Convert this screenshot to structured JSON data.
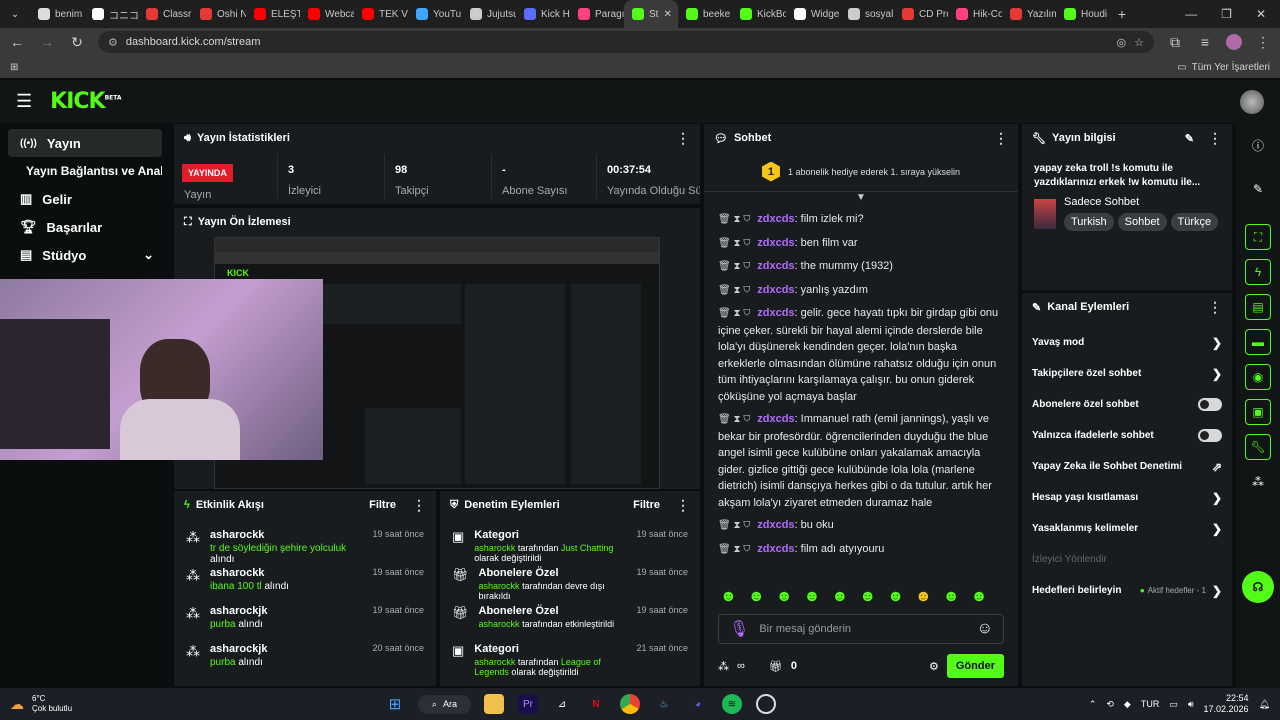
{
  "browser": {
    "tabs": [
      {
        "label": "benim",
        "color": "#dddddd"
      },
      {
        "label": "コニコ",
        "color": "#ffffff"
      },
      {
        "label": "Classr",
        "color": "#e53935"
      },
      {
        "label": "Oshi N",
        "color": "#e53935"
      },
      {
        "label": "ELEŞTİ",
        "color": "#ff0000"
      },
      {
        "label": "Webca",
        "color": "#ff0000"
      },
      {
        "label": "TEK Vİ",
        "color": "#ff0000"
      },
      {
        "label": "YouTu",
        "color": "#3ea6ff"
      },
      {
        "label": "Jujutsu",
        "color": "#cccccc"
      },
      {
        "label": "Kick H",
        "color": "#5b6cff"
      },
      {
        "label": "Paragı",
        "color": "#ff4081"
      },
      {
        "label": "St",
        "color": "#53fc18"
      },
      {
        "label": "beeke",
        "color": "#53fc18"
      },
      {
        "label": "KickBo",
        "color": "#53fc18"
      },
      {
        "label": "Widge",
        "color": "#ffffff"
      },
      {
        "label": "sosyal",
        "color": "#cccccc"
      },
      {
        "label": "CD Pro",
        "color": "#e53935"
      },
      {
        "label": "Hik-Co",
        "color": "#ff4081"
      },
      {
        "label": "Yazılım",
        "color": "#e53935"
      },
      {
        "label": "Houdi",
        "color": "#53fc18"
      }
    ],
    "url": "dashboard.kick.com/stream",
    "bookmarks_label": "Tüm Yer İşaretleri"
  },
  "kick": {
    "logo": "KICK",
    "beta": "BETA"
  },
  "sidebar": {
    "items": [
      {
        "label": "Yayın",
        "icon": "broadcast-icon"
      },
      {
        "label": "Yayın Bağlantısı ve Anahtarı",
        "icon": ""
      },
      {
        "label": "Gelir",
        "icon": "revenue-icon"
      },
      {
        "label": "Başarılar",
        "icon": "trophy-icon"
      },
      {
        "label": "Stüdyo",
        "icon": "studio-icon"
      }
    ]
  },
  "stats": {
    "title": "Yayın İstatistikleri",
    "live_badge": "YAYINDA",
    "cells": [
      {
        "value": "",
        "label": "Yayın"
      },
      {
        "value": "3",
        "label": "İzleyici"
      },
      {
        "value": "98",
        "label": "Takipçi"
      },
      {
        "value": "-",
        "label": "Abone Sayısı"
      },
      {
        "value": "00:37:54",
        "label": "Yayında Olduğu Süre"
      }
    ]
  },
  "preview": {
    "title": "Yayın Ön İzlemesi"
  },
  "activity": {
    "title": "Etkinlik Akışı",
    "filter": "Filtre",
    "items": [
      {
        "user": "asharockk",
        "detail": "tr de söylediğin şehire yolculuk",
        "suffix": "alındı",
        "time": "19 saat önce"
      },
      {
        "user": "asharockk",
        "detail": "ibana 100 tl",
        "suffix": "alındı",
        "time": "19 saat önce"
      },
      {
        "user": "asharockjk",
        "detail": "purba",
        "suffix": "alındı",
        "time": "19 saat önce"
      },
      {
        "user": "asharockjk",
        "detail": "purba",
        "suffix": "alındı",
        "time": "20 saat önce"
      }
    ]
  },
  "moderation": {
    "title": "Denetim Eylemleri",
    "filter": "Filtre",
    "items": [
      {
        "title": "Kategori",
        "user": "asharockk",
        "mid": "tarafından",
        "detail": "Just Chatting",
        "suffix": "olarak değiştirildi",
        "time": "19 saat önce"
      },
      {
        "title": "Abonelere Özel",
        "user": "asharockk",
        "mid": "tarafından devre dışı bırakıldı",
        "detail": "",
        "suffix": "",
        "time": "19 saat önce"
      },
      {
        "title": "Abonelere Özel",
        "user": "asharockk",
        "mid": "tarafından etkinleştirildi",
        "detail": "",
        "suffix": "",
        "time": "19 saat önce"
      },
      {
        "title": "Kategori",
        "user": "asharockk",
        "mid": "tarafından",
        "detail": "League of Legends",
        "suffix": "olarak değiştirildi",
        "time": "21 saat önce"
      }
    ]
  },
  "chat": {
    "title": "Sohbet",
    "gift_rank": "1",
    "gift_text": "1 abonelik hediye ederek 1. sıraya yükselin",
    "messages": [
      {
        "user": "zdxcds",
        "text": ": film izlek mi?"
      },
      {
        "user": "zdxcds",
        "text": ": ben film var"
      },
      {
        "user": "zdxcds",
        "text": ": the mummy (1932)"
      },
      {
        "user": "zdxcds",
        "text": ": yanlış yazdım"
      },
      {
        "user": "zdxcds",
        "text": ": gelir. gece hayatı tıpkı bir girdap gibi onu içine çeker. sürekli bir hayal alemi içinde derslerde bile lola'yı düşünerek kendinden geçer. lola'nın başka erkeklerle olmasından ölümüne rahatsız olduğu için onun tüm ihtiyaçlarını karşılamaya çalışır. bu onun giderek çöküşüne yol açmaya başlar"
      },
      {
        "user": "zdxcds",
        "text": ": Immanuel rath (emil jannings), yaşlı ve bekar bir profesördür. öğrencilerinden duyduğu the blue angel isimli gece kulübüne onları yakalamak amacıyla gider. gizlice gittiği gece kulübünde lola lola (marlene dietrich) isimli dansçıya herkes gibi o da tutulur. artık her akşam lola'yı ziyaret etmeden duramaz hale"
      },
      {
        "user": "zdxcds",
        "text": ": bu oku"
      },
      {
        "user": "zdxcds",
        "text": ": film adı atyıyouru"
      }
    ],
    "input_placeholder": "Bir mesaj gönderin",
    "points": "∞",
    "count": "0",
    "send": "Gönder"
  },
  "stream_info": {
    "title": "Yayın bilgisi",
    "stream_title": "yapay zeka troll !s komutu ile yazdıklarınızı erkek !w komutu ile...",
    "category": "Sadece Sohbet",
    "tags": [
      "Turkish",
      "Sohbet",
      "Türkçe"
    ]
  },
  "channel_actions": {
    "title": "Kanal Eylemleri",
    "items": [
      {
        "label": "Yavaş mod",
        "control": "chevron"
      },
      {
        "label": "Takipçilere özel sohbet",
        "control": "chevron"
      },
      {
        "label": "Abonelere özel sohbet",
        "control": "toggle"
      },
      {
        "label": "Yalnızca ifadelerle sohbet",
        "control": "toggle"
      },
      {
        "label": "Yapay Zeka ile Sohbet Denetimi",
        "control": "external"
      },
      {
        "label": "Hesap yaşı kısıtlaması",
        "control": "chevron"
      },
      {
        "label": "Yasaklanmış kelimeler",
        "control": "chevron"
      },
      {
        "label": "İzleyici Yönlendir",
        "control": "none"
      },
      {
        "label": "Hedefleri belirleyin",
        "control": "chevron",
        "extra": "Aktif hedefler - 1"
      }
    ]
  },
  "taskbar": {
    "temp": "6°C",
    "weather": "Çok bulutlu",
    "search": "Ara",
    "lang": "TUR",
    "time": "22:54",
    "date": "17.02.2026"
  },
  "colors": {
    "accent": "#53fc18",
    "username": "#b26bff",
    "panel": "#191c1e"
  }
}
